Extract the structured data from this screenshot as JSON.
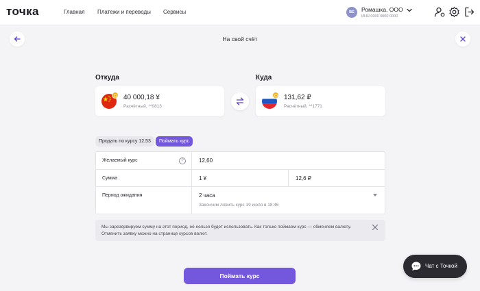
{
  "header": {
    "logo": "точка",
    "nav": [
      "Главная",
      "Платежи и переводы",
      "Сервисы"
    ],
    "company": {
      "initials": "ВЕ",
      "name": "Ромашка, ООО",
      "inn": "ИНН 0000 0000 0000"
    },
    "icons": [
      "user-settings-icon",
      "gear-icon",
      "logout-icon"
    ]
  },
  "page": {
    "title": "На свой счёт"
  },
  "from": {
    "label": "Откуда",
    "amount": "40 000,18 ¥",
    "account": "Расчётный, **0813",
    "flag": "china-flag-icon"
  },
  "to": {
    "label": "Куда",
    "amount": "131,62 ₽",
    "account": "Расчётный, **1771",
    "flag": "russia-flag-icon"
  },
  "tabs": {
    "sell": "Продать по курсу 12,53",
    "catch": "Поймать курс"
  },
  "form": {
    "rate_label": "Желаемый курс",
    "rate_value": "12,60",
    "sum_label": "Сумма",
    "sum_from": "1 ¥",
    "sum_to": "12,6 ₽",
    "period_label": "Период ожидания",
    "period_value": "2 часа",
    "period_hint": "Закончим ловить курс 19 июля в 18:46",
    "help": "?"
  },
  "notice": {
    "text": "Мы зарезервируем сумму на этот период, её нельзя будет использовать. Как только поймаем курс — обменяем валюту. Отменить заявку можно на странице курсов валют."
  },
  "chat": {
    "label": "Чат с Точкой"
  },
  "submit": {
    "label": "Поймать курс"
  },
  "colors": {
    "accent": "#7357dd",
    "background": "#f4f4f6",
    "chat": "#2a2a30",
    "coin": "#f2b01e"
  }
}
